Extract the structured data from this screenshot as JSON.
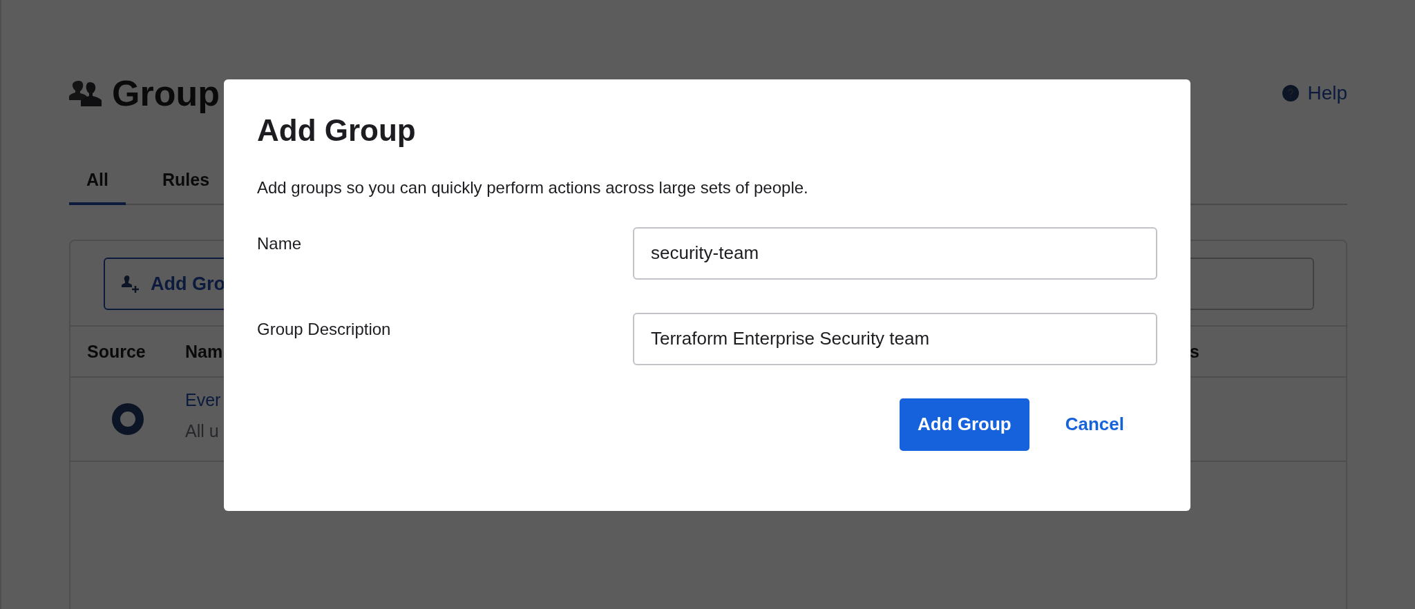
{
  "page": {
    "title": "Group",
    "help_link": "Help"
  },
  "tabs": [
    {
      "label": "All",
      "selected": true
    },
    {
      "label": "Rules",
      "selected": false
    }
  ],
  "toolbar": {
    "add_button": "Add Gro"
  },
  "table": {
    "columns": [
      "Source",
      "Nam",
      "s"
    ],
    "rows": [
      {
        "name": "Ever",
        "description": "All u"
      }
    ]
  },
  "modal": {
    "title": "Add Group",
    "description": "Add groups so you can quickly perform actions across large sets of people.",
    "fields": [
      {
        "label": "Name",
        "value": "security-team"
      },
      {
        "label": "Group Description",
        "value": "Terraform Enterprise Security team"
      }
    ],
    "buttons": [
      {
        "label": "Add Group",
        "kind": "primary"
      },
      {
        "label": "Cancel",
        "kind": "link"
      }
    ]
  }
}
